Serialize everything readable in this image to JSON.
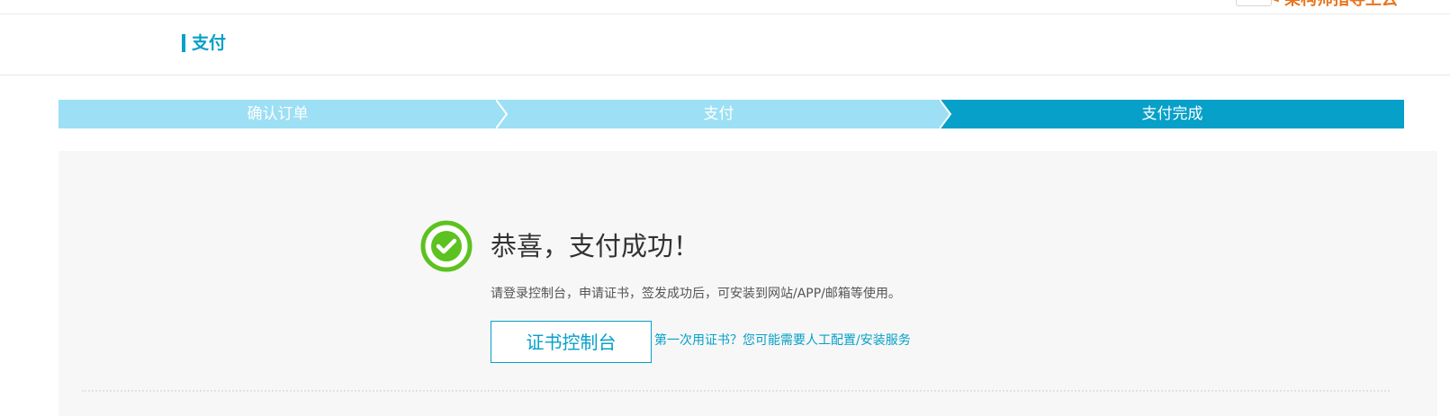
{
  "top": {
    "link_text": "架构师指导上云"
  },
  "header": {
    "title": "支付"
  },
  "steps": [
    {
      "label": "确认订单",
      "state": "done"
    },
    {
      "label": "支付",
      "state": "done"
    },
    {
      "label": "支付完成",
      "state": "active"
    }
  ],
  "result": {
    "icon": "check-circle-icon",
    "title": "恭喜，支付成功！",
    "description": "请登录控制台，申请证书，签发成功后，可安装到网站/APP/邮箱等使用。",
    "console_button": "证书控制台",
    "help_link": "第一次用证书？您可能需要人工配置/安装服务"
  },
  "colors": {
    "brand": "#06a0c8",
    "step_inactive": "#9ddff4",
    "success_green": "#5cc21f",
    "accent_orange": "#e8741c"
  }
}
